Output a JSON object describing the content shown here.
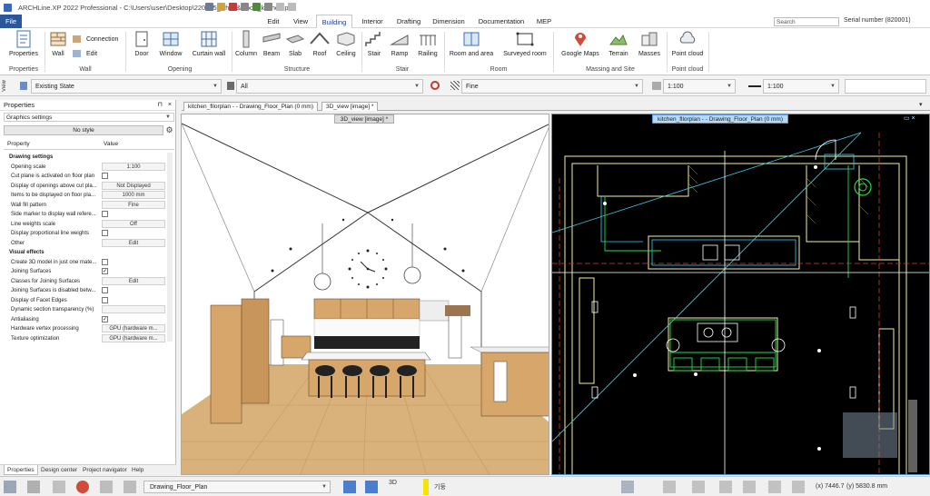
{
  "app": {
    "title": "ARCHLine.XP 2022 Professional - C:\\Users\\user\\Desktop\\220425_white&wood_kitchen.pro",
    "serial": "Serial number (820001)",
    "search_placeholder": "Search"
  },
  "menu_tabs": [
    "File",
    "Edit",
    "View",
    "Building",
    "Interior",
    "Drafting",
    "Dimension",
    "Documentation",
    "MEP"
  ],
  "active_menu_tab": "Building",
  "ribbon": {
    "buttons": {
      "properties": "Properties",
      "wall": "Wall",
      "connection": "Connection",
      "edit": "Edit",
      "door": "Door",
      "window": "Window",
      "curtain_wall": "Curtain wall",
      "column": "Column",
      "beam": "Beam",
      "slab": "Slab",
      "roof": "Roof",
      "ceiling": "Ceiling",
      "stair": "Stair",
      "ramp": "Ramp",
      "railing": "Railing",
      "room_and_area": "Room and area",
      "surveyed_room": "Surveyed room",
      "google_maps": "Google Maps",
      "terrain": "Terrain",
      "masses": "Masses",
      "point_cloud": "Point cloud"
    },
    "groups": {
      "properties": "Properties",
      "wall": "Wall",
      "opening": "Opening",
      "structure": "Structure",
      "stair": "Stair",
      "room": "Room",
      "massing": "Massing and Site",
      "point_cloud": "Point cloud"
    }
  },
  "viewbar": {
    "side_label": "View",
    "state": "Existing State",
    "layer": "All",
    "line": "Fine",
    "scale1": "1:100",
    "scale2": "1:100"
  },
  "properties_panel": {
    "title": "Properties",
    "category": "Graphics settings",
    "style": "No style",
    "col_property": "Property",
    "col_value": "Value",
    "rows": [
      {
        "label": "Drawing settings",
        "type": "section"
      },
      {
        "label": "Opening scale",
        "type": "value",
        "value": "1:100"
      },
      {
        "label": "Cut plane is activated on floor plan",
        "type": "check",
        "checked": false
      },
      {
        "label": "Display of openings above cut pla...",
        "type": "value",
        "value": "Not Displayed"
      },
      {
        "label": "Items to be displayed on floor pla...",
        "type": "value",
        "value": "1000 mm"
      },
      {
        "label": "Wall fill pattern",
        "type": "value",
        "value": "Fine"
      },
      {
        "label": "Side marker to display wall refere...",
        "type": "check",
        "checked": false
      },
      {
        "label": "Line weights scale",
        "type": "value",
        "value": "Off"
      },
      {
        "label": "Display proportional line weights",
        "type": "check",
        "checked": false
      },
      {
        "label": "Other",
        "type": "value",
        "value": "Edit"
      },
      {
        "label": "Visual effects",
        "type": "section"
      },
      {
        "label": "Create 3D model in just one mate...",
        "type": "check",
        "checked": false
      },
      {
        "label": "Joining Surfaces",
        "type": "check",
        "checked": true
      },
      {
        "label": "Classes for Joining Surfaces",
        "type": "value",
        "value": "Edit"
      },
      {
        "label": "Joining Surfaces is disabled betw...",
        "type": "check",
        "checked": false
      },
      {
        "label": "Display of Facet Edges",
        "type": "check",
        "checked": false
      },
      {
        "label": "Dynamic section transparency (%)",
        "type": "value",
        "value": ""
      },
      {
        "label": "Antialiasing",
        "type": "check",
        "checked": true
      },
      {
        "label": "Hardware vertex processing",
        "type": "value",
        "value": "GPU (hardware m..."
      },
      {
        "label": "Texture optimization",
        "type": "value",
        "value": "GPU (hardware m..."
      }
    ],
    "bottom_tabs": [
      "Properties",
      "Design center",
      "Project navigator",
      "Help"
    ]
  },
  "doc_tabs": [
    "kitchen_fllorplan -  - Drawing_Floor_Plan (0 mm)",
    "3D_view [image] *"
  ],
  "view3d_title": "3D_view [image] *",
  "plan_title": "kitchen_fllorplan -  - Drawing_Floor_Plan (0 mm)",
  "status": {
    "drawing": "Drawing_Floor_Plan",
    "mode": "3D",
    "layer_label": "기둥",
    "x": "(x) 7446.7",
    "y": "(y) 5830.8 mm"
  },
  "colors": {
    "file_tab": "#2b579a",
    "active_tab_text": "#1e3f8c",
    "plan_bg": "#000000",
    "plan_wall": "#f5f0a0",
    "plan_cyan": "#39d0f0",
    "plan_green": "#23e04a",
    "wood": "#d4a463"
  }
}
